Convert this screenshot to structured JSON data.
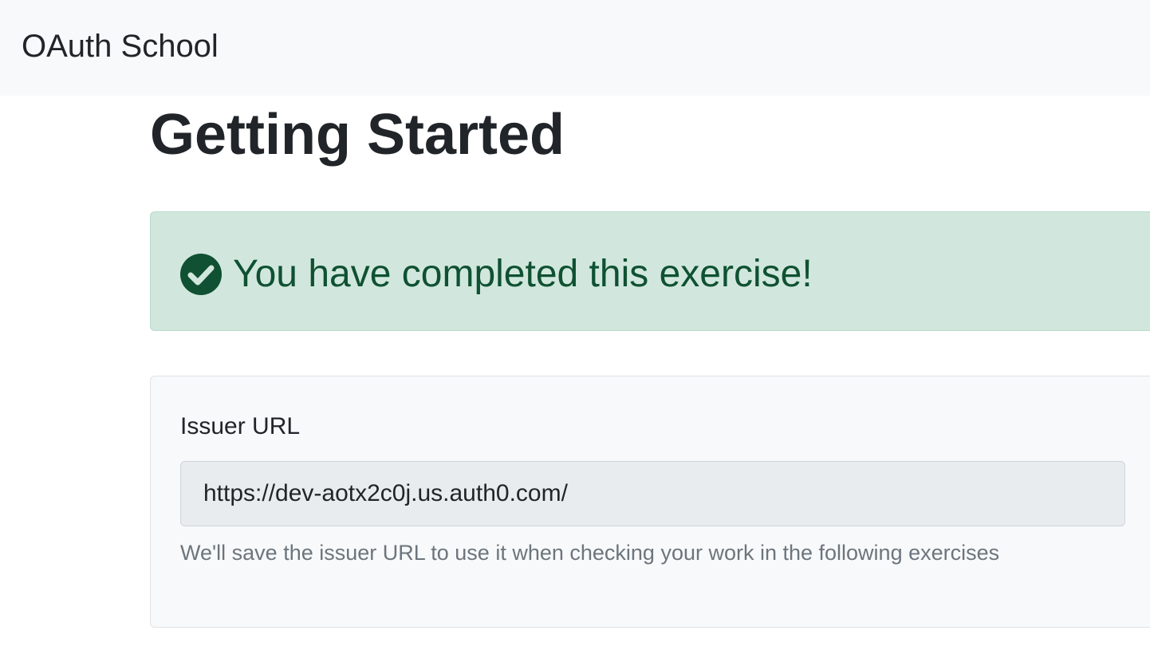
{
  "navbar": {
    "brand": "OAuth School"
  },
  "page": {
    "title": "Getting Started"
  },
  "alert": {
    "icon": "check-circle-icon",
    "message": "You have completed this exercise!",
    "color": "#0f5132",
    "background": "#d1e7dd"
  },
  "form": {
    "issuer_label": "Issuer URL",
    "issuer_value": "https://dev-aotx2c0j.us.auth0.com/",
    "issuer_help": "We'll save the issuer URL to use it when checking your work in the following exercises"
  }
}
